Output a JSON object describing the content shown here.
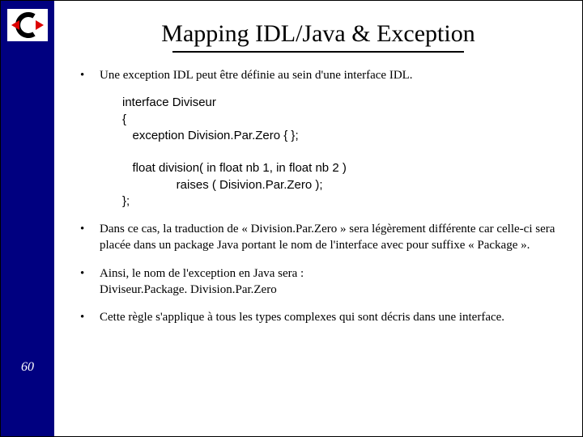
{
  "page_number": "60",
  "title": "Mapping IDL/Java & Exception",
  "bullets": {
    "b1": "Une exception IDL peut être définie au sein d'une interface IDL.",
    "b2": "Dans ce cas, la traduction de « Division.Par.Zero » sera légèrement différente car celle-ci sera placée dans un package Java portant le nom de l'interface avec pour suffixe « Package ».",
    "b3": "Ainsi, le nom de l'exception en Java sera :\nDiviseur.Package. Division.Par.Zero",
    "b4": "Cette règle s'applique à tous les types complexes qui sont décris dans une interface."
  },
  "code": "interface Diviseur\n{\n   exception Division.Par.Zero { };\n\n   float division( in float nb 1, in float nb 2 )\n                raises ( Disivion.Par.Zero );\n};"
}
